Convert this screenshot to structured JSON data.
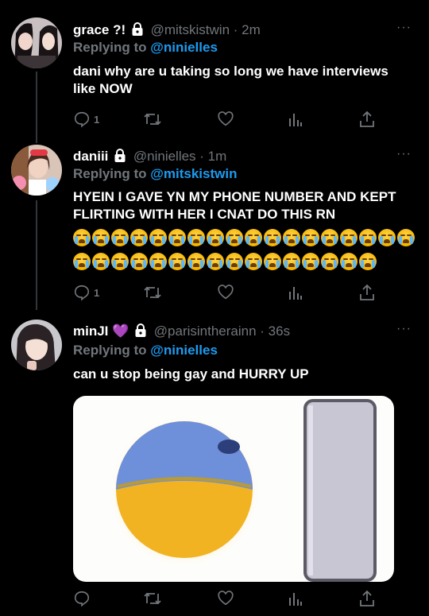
{
  "tweets": [
    {
      "name": "grace ?!",
      "handle": "@mitskistwin",
      "time": "· 2m",
      "replying_prefix": "Replying to",
      "replying_to": "@ninielles",
      "text": "dani why are u taking so long we have interviews like NOW",
      "reply_count": "1",
      "more": "···"
    },
    {
      "name": "daniii",
      "handle": "@ninielles",
      "time": "· 1m",
      "replying_prefix": "Replying to",
      "replying_to": "@mitskistwin",
      "text": "HYEIN I GAVE YN MY PHONE NUMBER AND KEPT FLIRTING WITH HER I CNAT DO THIS RN",
      "emoji": "😭",
      "emoji_count_row1": 18,
      "emoji_count_row2": 16,
      "reply_count": "1",
      "more": "···"
    },
    {
      "name": "minJI",
      "name_emoji": "💜",
      "handle": "@parisintherainn",
      "time": "· 36s",
      "replying_prefix": "Replying to",
      "replying_to": "@ninielles",
      "text": "can u stop being gay and HURRY UP",
      "reply_count": "",
      "more": "···"
    }
  ],
  "colors": {
    "background": "#000000",
    "link": "#1d9bf0",
    "muted": "#71767b",
    "text": "#ffffff"
  }
}
